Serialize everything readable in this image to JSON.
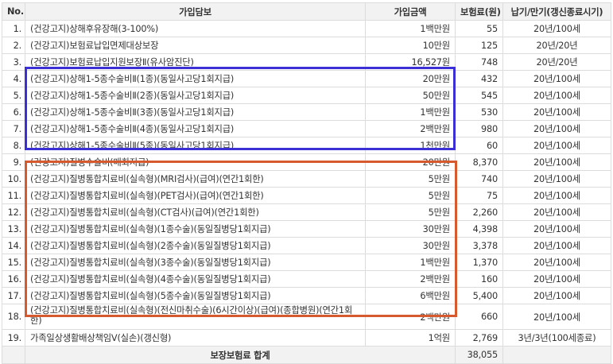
{
  "headers": {
    "no": "No.",
    "name": "가입담보",
    "amount": "가입금액",
    "premium": "보험료(원)",
    "term": "납기/만기(갱신종료시기)"
  },
  "rows": [
    {
      "no": "1.",
      "name": "(건강고지)상해후유장해(3-100%)",
      "amount": "1백만원",
      "premium": "55",
      "term": "20년/100세"
    },
    {
      "no": "2.",
      "name": "(건강고지)보험료납입면제대상보장",
      "amount": "10만원",
      "premium": "125",
      "term": "20년/20년"
    },
    {
      "no": "3.",
      "name": "(건강고지)보험료납입지원보장Ⅱ(유사암진단)",
      "amount": "16,527원",
      "premium": "748",
      "term": "20년/20년"
    },
    {
      "no": "4.",
      "name": "(건강고지)상해1-5종수술비Ⅱ(1종)(동일사고당1회지급)",
      "amount": "20만원",
      "premium": "432",
      "term": "20년/100세"
    },
    {
      "no": "5.",
      "name": "(건강고지)상해1-5종수술비Ⅱ(2종)(동일사고당1회지급)",
      "amount": "50만원",
      "premium": "545",
      "term": "20년/100세"
    },
    {
      "no": "6.",
      "name": "(건강고지)상해1-5종수술비Ⅱ(3종)(동일사고당1회지급)",
      "amount": "1백만원",
      "premium": "530",
      "term": "20년/100세"
    },
    {
      "no": "7.",
      "name": "(건강고지)상해1-5종수술비Ⅱ(4종)(동일사고당1회지급)",
      "amount": "2백만원",
      "premium": "980",
      "term": "20년/100세"
    },
    {
      "no": "8.",
      "name": "(건강고지)상해1-5종수술비Ⅱ(5종)(동일사고당1회지급)",
      "amount": "1천만원",
      "premium": "60",
      "term": "20년/100세"
    },
    {
      "no": "9.",
      "name": "(건강고지)질병수술비(매회지급)",
      "amount": "20만원",
      "premium": "8,370",
      "term": "20년/100세"
    },
    {
      "no": "10.",
      "name": "(건강고지)질병통합치료비(실속형)(MRI검사)(급여)(연간1회한)",
      "amount": "5만원",
      "premium": "740",
      "term": "20년/100세"
    },
    {
      "no": "11.",
      "name": "(건강고지)질병통합치료비(실속형)(PET검사)(급여)(연간1회한)",
      "amount": "5만원",
      "premium": "75",
      "term": "20년/100세"
    },
    {
      "no": "12.",
      "name": "(건강고지)질병통합치료비(실속형)(CT검사)(급여)(연간1회한)",
      "amount": "5만원",
      "premium": "2,260",
      "term": "20년/100세"
    },
    {
      "no": "13.",
      "name": "(건강고지)질병통합치료비(실속형)(1종수술)(동일질병당1회지급)",
      "amount": "30만원",
      "premium": "4,398",
      "term": "20년/100세"
    },
    {
      "no": "14.",
      "name": "(건강고지)질병통합치료비(실속형)(2종수술)(동일질병당1회지급)",
      "amount": "30만원",
      "premium": "3,378",
      "term": "20년/100세"
    },
    {
      "no": "15.",
      "name": "(건강고지)질병통합치료비(실속형)(3종수술)(동일질병당1회지급)",
      "amount": "1백만원",
      "premium": "1,370",
      "term": "20년/100세"
    },
    {
      "no": "16.",
      "name": "(건강고지)질병통합치료비(실속형)(4종수술)(동일질병당1회지급)",
      "amount": "2백만원",
      "premium": "160",
      "term": "20년/100세"
    },
    {
      "no": "17.",
      "name": "(건강고지)질병통합치료비(실속형)(5종수술)(동일질병당1회지급)",
      "amount": "6백만원",
      "premium": "5,400",
      "term": "20년/100세"
    },
    {
      "no": "18.",
      "name": "(건강고지)질병통합치료비(실속형)(전신마취수술)(6시간이상)(급여)(종합병원)(연간1회한)",
      "amount": "2백만원",
      "premium": "660",
      "term": "20년/100세"
    },
    {
      "no": "19.",
      "name": "가족일상생활배상책임Ⅴ(실손)(갱신형)",
      "amount": "1억원",
      "premium": "2,769",
      "term": "3년/3년(100세종료)"
    }
  ],
  "total": {
    "label": "보장보험료 합계",
    "premium": "38,055"
  },
  "highlight_colors": {
    "blue": "#3b2fd6",
    "red": "#d65a2e"
  }
}
